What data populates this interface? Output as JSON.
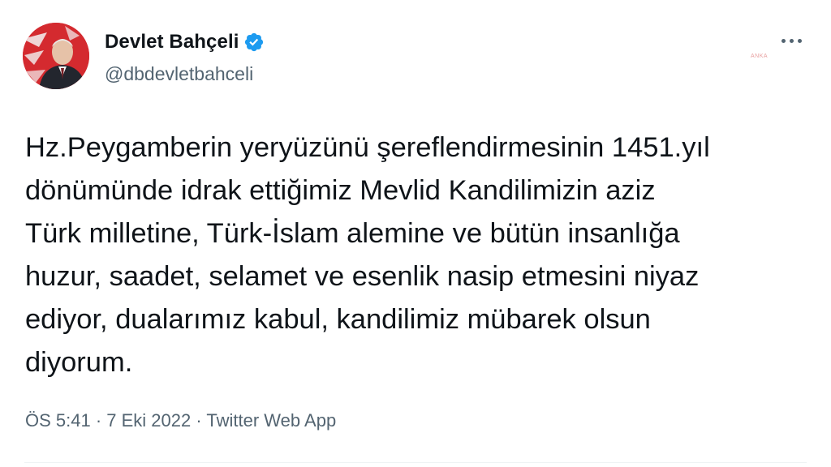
{
  "author": {
    "display_name": "Devlet Bahçeli",
    "handle": "@dbdevletbahceli",
    "verified": true,
    "avatar_icon": "profile-photo"
  },
  "tweet": {
    "lines": [
      "Hz.Peygamberin yeryüzünü şereflendirmesinin 1451.yıl",
      "dönümünde idrak ettiğimiz Mevlid Kandilimizin aziz",
      "Türk milletine, Türk-İslam alemine ve bütün insanlığa",
      "huzur, saadet, selamet ve esenlik nasip etmesini niyaz",
      "ediyor, dualarımız kabul, kandilimiz mübarek olsun",
      "diyorum."
    ],
    "time": "ÖS 5:41",
    "separator": " · ",
    "date": "7 Eki 2022",
    "source": "Twitter Web App"
  },
  "watermark": "ANKA",
  "colors": {
    "text": "#0f1419",
    "secondary": "#536471",
    "verified": "#1d9bf0",
    "avatar_bg": "#d9232e"
  },
  "icons": {
    "more": "more-dots-icon",
    "verified": "verified-badge-icon"
  }
}
